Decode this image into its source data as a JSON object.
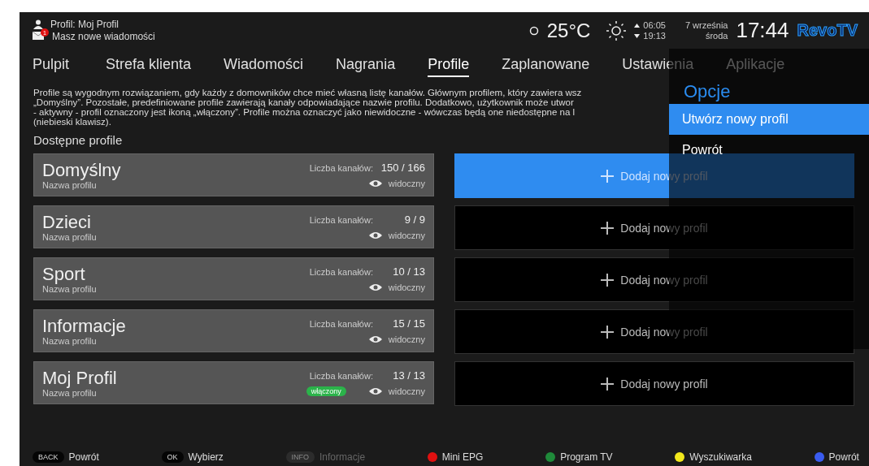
{
  "status": {
    "profile": "Profil: Moj Profil",
    "messages": "Masz nowe wiadomości",
    "message_badge": "1"
  },
  "weather": {
    "temperature": "25°C",
    "sunrise": "06:05",
    "sunset": "19:13"
  },
  "date": {
    "day": "7 września",
    "weekday": "środa"
  },
  "clock": "17:44",
  "logo": "RevoTV",
  "tabs": [
    {
      "label": "Pulpit",
      "selected": false
    },
    {
      "label": "Strefa klienta",
      "selected": false
    },
    {
      "label": "Wiadomości",
      "selected": false
    },
    {
      "label": "Nagrania",
      "selected": false
    },
    {
      "label": "Profile",
      "selected": true
    },
    {
      "label": "Zaplanowane",
      "selected": false
    },
    {
      "label": "Ustawienia",
      "selected": false
    },
    {
      "label": "Aplikacje",
      "selected": false
    }
  ],
  "description": [
    "Profile są wygodnym rozwiązaniem, gdy każdy z domowników chce mieć własną listę kanałów. Głównym profilem, który zawiera wsz",
    "„Domyślny”. Pozostałe, predefiniowane profile zawierają kanały odpowiadające nazwie profilu. Dodatkowo, użytkownik może utwor",
    "- aktywny - profil oznaczony jest ikoną „włączony”. Profile można oznaczyć jako niewidoczne - wówczas będą one niedostępne na l",
    "(niebieski klawisz)."
  ],
  "section_title": "Dostępne profile",
  "profiles": [
    {
      "name": "Domyślny",
      "subtitle": "Nazwa profilu",
      "channels_label": "Liczba kanałów:",
      "channels": "150 / 166",
      "visibility": "widoczny"
    },
    {
      "name": "Dzieci",
      "subtitle": "Nazwa profilu",
      "channels_label": "Liczba kanałów:",
      "channels": "9 / 9",
      "visibility": "widoczny"
    },
    {
      "name": "Sport",
      "subtitle": "Nazwa profilu",
      "channels_label": "Liczba kanałów:",
      "channels": "10 / 13",
      "visibility": "widoczny"
    },
    {
      "name": "Informacje",
      "subtitle": "Nazwa profilu",
      "channels_label": "Liczba kanałów:",
      "channels": "15 / 15",
      "visibility": "widoczny"
    },
    {
      "name": "Moj Profil",
      "subtitle": "Nazwa profilu",
      "channels_label": "Liczba kanałów:",
      "channels": "13 / 13",
      "badge": "włączony",
      "visibility": "widoczny"
    }
  ],
  "add_buttons": [
    {
      "label": "Dodaj nowy profil",
      "selected": true
    },
    {
      "label": "Dodaj nowy profil",
      "selected": false
    },
    {
      "label": "Dodaj nowy profil",
      "selected": false
    },
    {
      "label": "Dodaj nowy profil",
      "selected": false
    },
    {
      "label": "Dodaj nowy profil",
      "selected": false
    }
  ],
  "options": {
    "title": "Opcje",
    "items": [
      {
        "label": "Utwórz nowy profil",
        "selected": true
      },
      {
        "label": "Powrót",
        "selected": false
      }
    ]
  },
  "footer": [
    {
      "kind": "key",
      "key": "BACK",
      "label": "Powrót",
      "disabled": false
    },
    {
      "kind": "key",
      "key": "OK",
      "label": "Wybierz",
      "disabled": false
    },
    {
      "kind": "key",
      "key": "INFO",
      "label": "Informacje",
      "disabled": true
    },
    {
      "kind": "color",
      "color": "#e01010",
      "label": "Mini EPG"
    },
    {
      "kind": "color",
      "color": "#1f8a3a",
      "label": "Program TV"
    },
    {
      "kind": "color",
      "color": "#f2e81c",
      "label": "Wyszukiwarka"
    },
    {
      "kind": "color",
      "color": "#3a5cf0",
      "label": "Powrót"
    }
  ]
}
